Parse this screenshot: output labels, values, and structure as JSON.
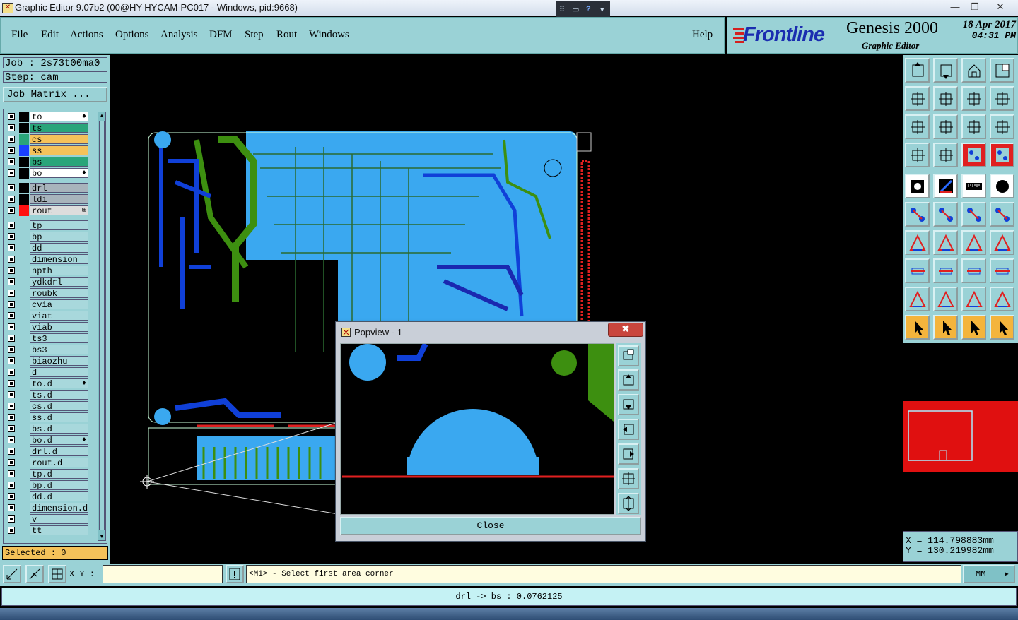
{
  "window": {
    "title": "Graphic Editor 9.07b2 (00@HY-HYCAM-PC017 - Windows, pid:9668)"
  },
  "menu": {
    "items": [
      "File",
      "Edit",
      "Actions",
      "Options",
      "Analysis",
      "DFM",
      "Step",
      "Rout",
      "Windows"
    ],
    "help": "Help"
  },
  "brand": {
    "logo": "Frontline",
    "product": "Genesis 2000",
    "subtitle": "Graphic Editor",
    "date": "18 Apr 2017",
    "time": "04:31 PM"
  },
  "job": {
    "job_label": "Job : 2s73t00ma0",
    "step_label": "Step: cam",
    "matrix_button": "Job Matrix ..."
  },
  "layers": [
    {
      "name": "to",
      "color": "#ffffff",
      "mark": "♦"
    },
    {
      "name": "ts",
      "color": "#2aa57a"
    },
    {
      "name": "cs",
      "color": "#f4c25a"
    },
    {
      "name": "ss",
      "color": "#f4c25a"
    },
    {
      "name": "bs",
      "color": "#2aa57a"
    },
    {
      "name": "bo",
      "color": "#ffffff",
      "mark": "♦"
    },
    {
      "name": "drl",
      "color": "#a8b4bc"
    },
    {
      "name": "ldi",
      "color": "#a8b4bc"
    },
    {
      "name": "rout",
      "color": "#dddddd",
      "mark": "⊞"
    },
    {
      "name": "tp"
    },
    {
      "name": "bp"
    },
    {
      "name": "dd"
    },
    {
      "name": "dimension"
    },
    {
      "name": "npth"
    },
    {
      "name": "ydkdrl"
    },
    {
      "name": "roubk"
    },
    {
      "name": "cvia"
    },
    {
      "name": "viat"
    },
    {
      "name": "viab"
    },
    {
      "name": "ts3"
    },
    {
      "name": "bs3"
    },
    {
      "name": "biaozhu"
    },
    {
      "name": "d"
    },
    {
      "name": "to.d",
      "mark": "♦"
    },
    {
      "name": "ts.d"
    },
    {
      "name": "cs.d"
    },
    {
      "name": "ss.d"
    },
    {
      "name": "bs.d"
    },
    {
      "name": "bo.d",
      "mark": "♦"
    },
    {
      "name": "drl.d"
    },
    {
      "name": "rout.d"
    },
    {
      "name": "tp.d"
    },
    {
      "name": "bp.d"
    },
    {
      "name": "dd.d"
    },
    {
      "name": "dimension.d"
    },
    {
      "name": "v"
    },
    {
      "name": "tt"
    }
  ],
  "selected": "Selected : 0",
  "popview": {
    "title": "Popview - 1",
    "close_x": "✖",
    "close_button": "Close"
  },
  "coords": {
    "x": "X = 114.798883mm",
    "y": "Y = 130.219982mm"
  },
  "bottom": {
    "xy_label": "X Y :",
    "xy_value": "",
    "message": "<M1> - Select first area corner",
    "units": "MM",
    "status": "drl -> bs : 0.0762125"
  },
  "colors": {
    "panel": "#9ad2d6",
    "board": "#3aa8f0",
    "copper_green": "#3d8f10",
    "trace_blue": "#1040d8",
    "rout_red": "#e02020"
  },
  "icons": [
    "file-icon",
    "close-icon",
    "minimize-icon",
    "maximize-icon",
    "restore-icon",
    "help-icon",
    "checkbox-icon"
  ]
}
